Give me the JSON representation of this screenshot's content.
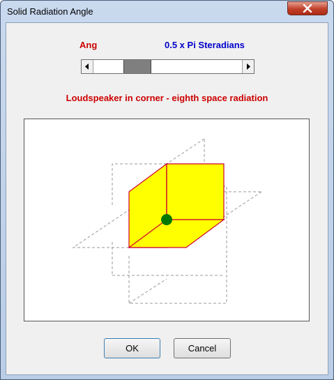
{
  "window": {
    "title": "Solid Radiation Angle"
  },
  "angle": {
    "label": "Ang",
    "value_text": "0.5 x Pi Steradians",
    "slider_position": 0.25
  },
  "description": "Loudspeaker in corner - eighth space radiation",
  "diagram": {
    "cube_fill": "#ffff00",
    "cube_edge": "#cc0033",
    "source_color": "#007700",
    "guide_color": "#999999"
  },
  "buttons": {
    "ok": "OK",
    "cancel": "Cancel"
  },
  "icons": {
    "close": "close-icon",
    "scroll_left": "arrow-left-icon",
    "scroll_right": "arrow-right-icon"
  },
  "colors": {
    "label_red": "#cc0000",
    "value_blue": "#0000cc"
  }
}
